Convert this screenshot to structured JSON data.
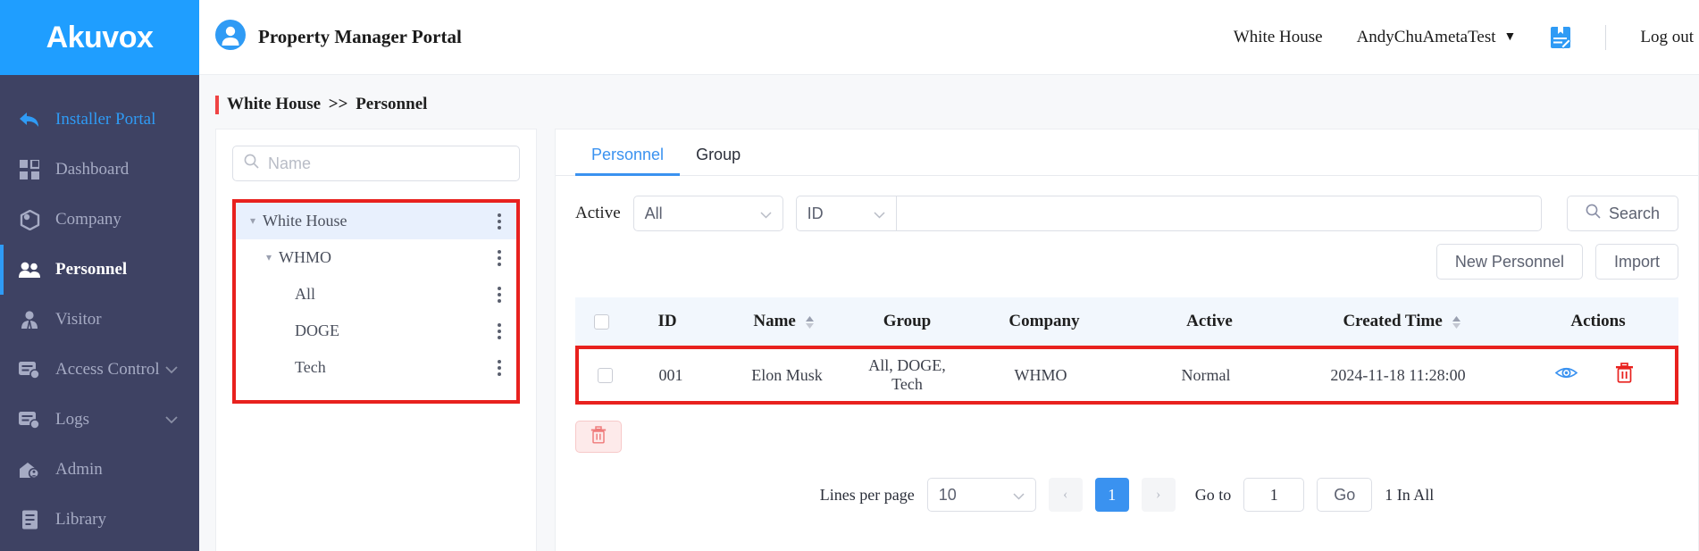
{
  "brand": {
    "logo_text": "Akuvox",
    "logo_bg": "#1f9eff",
    "sidebar_bg": "#3e4263",
    "accent": "#3a92f0",
    "danger": "#e8211e"
  },
  "sidebar": {
    "items": [
      {
        "label": "Installer Portal",
        "icon": "back-arrow-icon",
        "state": "link"
      },
      {
        "label": "Dashboard",
        "icon": "dashboard-grid-icon",
        "state": "normal"
      },
      {
        "label": "Company",
        "icon": "company-icon",
        "state": "normal"
      },
      {
        "label": "Personnel",
        "icon": "people-icon",
        "state": "active"
      },
      {
        "label": "Visitor",
        "icon": "visitor-icon",
        "state": "normal"
      },
      {
        "label": "Access Control",
        "icon": "access-card-icon",
        "state": "normal",
        "expandable": true
      },
      {
        "label": "Logs",
        "icon": "logs-icon",
        "state": "normal",
        "expandable": true
      },
      {
        "label": "Admin",
        "icon": "admin-home-icon",
        "state": "normal"
      },
      {
        "label": "Library",
        "icon": "library-icon",
        "state": "normal"
      }
    ]
  },
  "topbar": {
    "portal_title": "Property Manager Portal",
    "avatar_icon": "user-avatar-icon",
    "site": "White House",
    "account": "AndyChuAmetaTest",
    "account_caret": "▼",
    "note_icon": "note-document-icon",
    "logout": "Log out"
  },
  "breadcrumb": {
    "root": "White House",
    "sep": ">>",
    "current": "Personnel"
  },
  "tree_panel": {
    "search_placeholder": "Name",
    "search_icon": "search-icon",
    "nodes": [
      {
        "label": "White House",
        "level": 0,
        "caret": "▾",
        "selected": true
      },
      {
        "label": "WHMO",
        "level": 1,
        "caret": "▾",
        "selected": false
      },
      {
        "label": "All",
        "level": 2,
        "caret": "",
        "selected": false
      },
      {
        "label": "DOGE",
        "level": 2,
        "caret": "",
        "selected": false
      },
      {
        "label": "Tech",
        "level": 2,
        "caret": "",
        "selected": false
      }
    ]
  },
  "tabs": [
    {
      "label": "Personnel",
      "active": true
    },
    {
      "label": "Group",
      "active": false
    }
  ],
  "filters": {
    "active_label": "Active",
    "active_value": "All",
    "field_value": "ID",
    "keyword_value": "",
    "keyword_placeholder": "",
    "search_button": "Search",
    "search_icon": "search-icon"
  },
  "actions": {
    "new_personnel": "New Personnel",
    "import": "Import"
  },
  "table": {
    "columns": [
      {
        "key": "checkbox",
        "label": "",
        "sortable": false
      },
      {
        "key": "id",
        "label": "ID",
        "sortable": false
      },
      {
        "key": "name",
        "label": "Name",
        "sortable": true
      },
      {
        "key": "group",
        "label": "Group",
        "sortable": false
      },
      {
        "key": "company",
        "label": "Company",
        "sortable": false
      },
      {
        "key": "active",
        "label": "Active",
        "sortable": false
      },
      {
        "key": "created_time",
        "label": "Created Time",
        "sortable": true
      },
      {
        "key": "actions",
        "label": "Actions",
        "sortable": false
      }
    ],
    "rows": [
      {
        "id": "001",
        "name": "Elon Musk",
        "group": "All, DOGE, Tech",
        "company": "WHMO",
        "active": "Normal",
        "created_time": "2024-11-18 11:28:00",
        "row_actions": [
          {
            "icon": "eye-view-icon",
            "color": "#3a92f0"
          },
          {
            "icon": "trash-delete-icon",
            "color": "#e8211e"
          }
        ]
      }
    ],
    "bulk_delete_icon": "trash-delete-icon"
  },
  "pagination": {
    "lines_label": "Lines per page",
    "lines_value": "10",
    "prev": "‹",
    "current_page": "1",
    "next": "›",
    "goto_label": "Go to",
    "goto_value": "1",
    "go_button": "Go",
    "total_text": "1 In All"
  }
}
